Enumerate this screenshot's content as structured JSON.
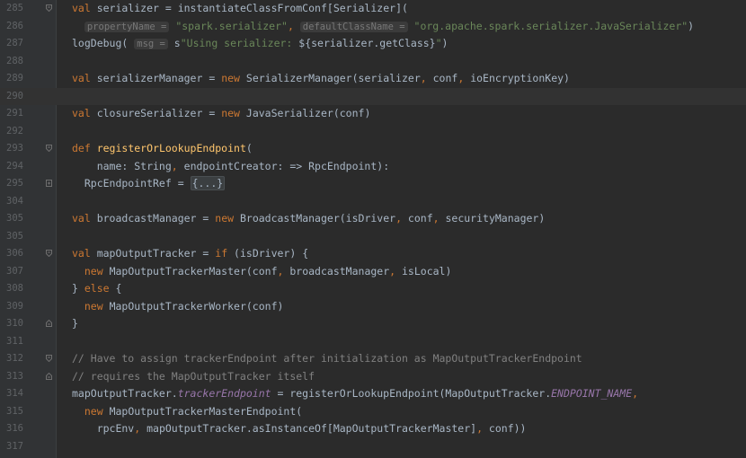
{
  "lines": [
    {
      "num": "285",
      "fold": "open",
      "segs": [
        {
          "c": "kw",
          "t": "val "
        },
        {
          "t": "serializer = instantiateClassFromConf["
        },
        {
          "t": "Serializer"
        },
        {
          "t": "]("
        }
      ]
    },
    {
      "num": "286",
      "fold": "",
      "segs": [
        {
          "t": "  "
        },
        {
          "c": "hint",
          "t": "propertyName ="
        },
        {
          "t": " "
        },
        {
          "c": "str",
          "t": "\"spark.serializer\""
        },
        {
          "c": "kw",
          "t": ", "
        },
        {
          "c": "hint",
          "t": "defaultClassName ="
        },
        {
          "t": " "
        },
        {
          "c": "str",
          "t": "\"org.apache.spark.serializer.JavaSerializer\""
        },
        {
          "t": ")"
        }
      ]
    },
    {
      "num": "287",
      "fold": "",
      "segs": [
        {
          "t": "logDebug( "
        },
        {
          "c": "hint",
          "t": "msg ="
        },
        {
          "t": " s"
        },
        {
          "c": "str",
          "t": "\"Using serializer: "
        },
        {
          "t": "${serializer.getClass}"
        },
        {
          "c": "str",
          "t": "\""
        },
        {
          "t": ")"
        }
      ]
    },
    {
      "num": "288",
      "fold": "",
      "segs": []
    },
    {
      "num": "289",
      "fold": "",
      "segs": [
        {
          "c": "kw",
          "t": "val "
        },
        {
          "t": "serializerManager = "
        },
        {
          "c": "kw",
          "t": "new "
        },
        {
          "t": "SerializerManager(serializer"
        },
        {
          "c": "kw",
          "t": ", "
        },
        {
          "t": "conf"
        },
        {
          "c": "kw",
          "t": ", "
        },
        {
          "t": "ioEncryptionKey)"
        }
      ]
    },
    {
      "num": "290",
      "fold": "",
      "segs": [],
      "current": true
    },
    {
      "num": "291",
      "fold": "",
      "segs": [
        {
          "c": "kw",
          "t": "val "
        },
        {
          "t": "closureSerializer = "
        },
        {
          "c": "kw",
          "t": "new "
        },
        {
          "t": "JavaSerializer(conf)"
        }
      ]
    },
    {
      "num": "292",
      "fold": "",
      "segs": []
    },
    {
      "num": "293",
      "fold": "open",
      "segs": [
        {
          "c": "kw",
          "t": "def "
        },
        {
          "c": "fn",
          "t": "registerOrLookupEndpoint"
        },
        {
          "t": "("
        }
      ]
    },
    {
      "num": "294",
      "fold": "",
      "segs": [
        {
          "t": "    name: String"
        },
        {
          "c": "kw",
          "t": ", "
        },
        {
          "t": "endpointCreator: => RpcEndpoint):"
        }
      ]
    },
    {
      "num": "295",
      "fold": "closed",
      "segs": [
        {
          "t": "  RpcEndpointRef = "
        },
        {
          "c": "fc",
          "t": "{...}"
        }
      ]
    },
    {
      "num": "304",
      "fold": "",
      "segs": []
    },
    {
      "num": "305",
      "fold": "",
      "segs": [
        {
          "c": "kw",
          "t": "val "
        },
        {
          "t": "broadcastManager = "
        },
        {
          "c": "kw",
          "t": "new "
        },
        {
          "t": "BroadcastManager(isDriver"
        },
        {
          "c": "kw",
          "t": ", "
        },
        {
          "t": "conf"
        },
        {
          "c": "kw",
          "t": ", "
        },
        {
          "t": "securityManager)"
        }
      ]
    },
    {
      "num": "305",
      "fold": "",
      "segs": []
    },
    {
      "num": "306",
      "fold": "open",
      "segs": [
        {
          "c": "kw",
          "t": "val "
        },
        {
          "t": "mapOutputTracker = "
        },
        {
          "c": "kw",
          "t": "if "
        },
        {
          "t": "(isDriver) {"
        }
      ]
    },
    {
      "num": "307",
      "fold": "",
      "segs": [
        {
          "t": "  "
        },
        {
          "c": "kw",
          "t": "new "
        },
        {
          "t": "MapOutputTrackerMaster(conf"
        },
        {
          "c": "kw",
          "t": ", "
        },
        {
          "t": "broadcastManager"
        },
        {
          "c": "kw",
          "t": ", "
        },
        {
          "t": "isLocal)"
        }
      ]
    },
    {
      "num": "308",
      "fold": "",
      "segs": [
        {
          "t": "} "
        },
        {
          "c": "kw",
          "t": "else "
        },
        {
          "t": "{"
        }
      ]
    },
    {
      "num": "309",
      "fold": "",
      "segs": [
        {
          "t": "  "
        },
        {
          "c": "kw",
          "t": "new "
        },
        {
          "t": "MapOutputTrackerWorker(conf)"
        }
      ]
    },
    {
      "num": "310",
      "fold": "end",
      "segs": [
        {
          "t": "}"
        }
      ]
    },
    {
      "num": "311",
      "fold": "",
      "segs": []
    },
    {
      "num": "312",
      "fold": "open",
      "segs": [
        {
          "c": "com",
          "t": "// Have to assign trackerEndpoint after initialization as MapOutputTrackerEndpoint"
        }
      ]
    },
    {
      "num": "313",
      "fold": "end",
      "segs": [
        {
          "c": "com",
          "t": "// requires the MapOutputTracker itself"
        }
      ]
    },
    {
      "num": "314",
      "fold": "",
      "segs": [
        {
          "t": "mapOutputTracker."
        },
        {
          "c": "fld",
          "t": "trackerEndpoint"
        },
        {
          "t": " = registerOrLookupEndpoint(MapOutputTracker."
        },
        {
          "c": "fld",
          "t": "ENDPOINT_NAME"
        },
        {
          "c": "kw",
          "t": ","
        }
      ]
    },
    {
      "num": "315",
      "fold": "",
      "segs": [
        {
          "t": "  "
        },
        {
          "c": "kw",
          "t": "new "
        },
        {
          "t": "MapOutputTrackerMasterEndpoint("
        }
      ]
    },
    {
      "num": "316",
      "fold": "",
      "segs": [
        {
          "t": "    rpcEnv"
        },
        {
          "c": "kw",
          "t": ", "
        },
        {
          "t": "mapOutputTracker.asInstanceOf[MapOutputTrackerMaster]"
        },
        {
          "c": "kw",
          "t": ", "
        },
        {
          "t": "conf))"
        }
      ]
    },
    {
      "num": "317",
      "fold": "",
      "segs": []
    }
  ]
}
